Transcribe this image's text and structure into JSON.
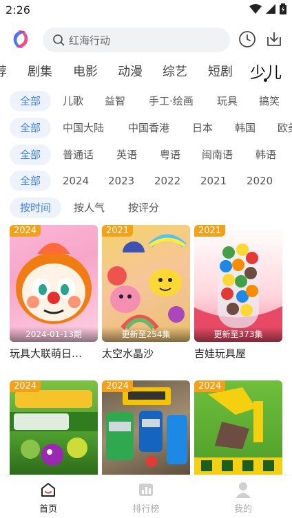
{
  "status": {
    "time": "2:26"
  },
  "search": {
    "placeholder": "红海行动"
  },
  "categories": [
    "荐",
    "剧集",
    "电影",
    "动漫",
    "综艺",
    "短剧",
    "少儿"
  ],
  "filters": {
    "type": [
      "全部",
      "儿歌",
      "益智",
      "手工·绘画",
      "玩具",
      "搞笑"
    ],
    "region": [
      "全部",
      "中国大陆",
      "中国香港",
      "日本",
      "韩国",
      "欧美"
    ],
    "language": [
      "全部",
      "普通话",
      "英语",
      "粤语",
      "闽南语",
      "韩语"
    ],
    "year": [
      "全部",
      "2024",
      "2023",
      "2022",
      "2021",
      "2020"
    ],
    "sort": [
      "按时间",
      "按人气",
      "按评分"
    ]
  },
  "cards": [
    {
      "year": "2024",
      "overlay": "2024-01-13期",
      "title": "玩具大联萌日…"
    },
    {
      "year": "2021",
      "overlay": "更新至254集",
      "title": "太空水晶沙"
    },
    {
      "year": "2021",
      "overlay": "更新至373集",
      "title": "吉娃玩具屋"
    },
    {
      "year": "2024",
      "overlay": "",
      "title": ""
    },
    {
      "year": "2024",
      "overlay": "",
      "title": ""
    },
    {
      "year": "2024",
      "overlay": "",
      "title": ""
    }
  ],
  "nav": {
    "home": "首页",
    "rank": "排行榜",
    "mine": "我的"
  },
  "colors": {
    "accent": "#3d7ef0",
    "badge": "#f6a017"
  }
}
